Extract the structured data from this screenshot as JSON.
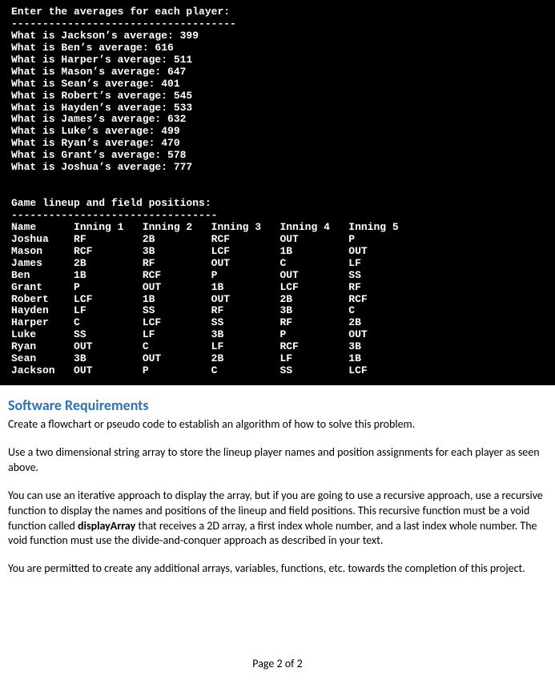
{
  "console": {
    "prompt_header": "Enter the averages for each player:",
    "divider": "------------------------------------",
    "prompts": [
      {
        "name": "Jackson",
        "value": "399"
      },
      {
        "name": "Ben",
        "value": "616"
      },
      {
        "name": "Harper",
        "value": "511"
      },
      {
        "name": "Mason",
        "value": "647"
      },
      {
        "name": "Sean",
        "value": "401"
      },
      {
        "name": "Robert",
        "value": "545"
      },
      {
        "name": "Hayden",
        "value": "533"
      },
      {
        "name": "James",
        "value": "632"
      },
      {
        "name": "Luke",
        "value": "499"
      },
      {
        "name": "Ryan",
        "value": "470"
      },
      {
        "name": "Grant",
        "value": "578"
      },
      {
        "name": "Joshua",
        "value": "777"
      }
    ],
    "lineup_title": "Game lineup and field positions:",
    "lineup_divider": "---------------------------------",
    "table": {
      "headers": [
        "Name",
        "Inning 1",
        "Inning 2",
        "Inning 3",
        "Inning 4",
        "Inning 5"
      ],
      "rows": [
        [
          "Joshua",
          "RF",
          "2B",
          "RCF",
          "OUT",
          "P"
        ],
        [
          "Mason",
          "RCF",
          "3B",
          "LCF",
          "1B",
          "OUT"
        ],
        [
          "James",
          "2B",
          "RF",
          "OUT",
          "C",
          "LF"
        ],
        [
          "Ben",
          "1B",
          "RCF",
          "P",
          "OUT",
          "SS"
        ],
        [
          "Grant",
          "P",
          "OUT",
          "1B",
          "LCF",
          "RF"
        ],
        [
          "Robert",
          "LCF",
          "1B",
          "OUT",
          "2B",
          "RCF"
        ],
        [
          "Hayden",
          "LF",
          "SS",
          "RF",
          "3B",
          "C"
        ],
        [
          "Harper",
          "C",
          "LCF",
          "SS",
          "RF",
          "2B"
        ],
        [
          "Luke",
          "SS",
          "LF",
          "3B",
          "P",
          "OUT"
        ],
        [
          "Ryan",
          "OUT",
          "C",
          "LF",
          "RCF",
          "3B"
        ],
        [
          "Sean",
          "3B",
          "OUT",
          "2B",
          "LF",
          "1B"
        ],
        [
          "Jackson",
          "OUT",
          "P",
          "C",
          "SS",
          "LCF"
        ]
      ]
    }
  },
  "doc": {
    "heading": "Software Requirements",
    "p1": "Create a flowchart or pseudo code to establish an algorithm of how to solve this problem.",
    "p2": "Use a two dimensional string array to store the lineup player names and position assignments for each player as seen above.",
    "p3a": "You can use an iterative approach to display the array, but if you are going to use a recursive approach, use a recursive function to display the names and positions of the lineup and field positions. This recursive function must be a void function called ",
    "p3b": "displayArray",
    "p3c": " that receives a 2D array, a first index whole number, and a last index whole number.  The void function must use the divide-and-conquer approach as described in your text.",
    "p4": "You are permitted to create any additional arrays, variables, functions, etc. towards the completion of this project.",
    "footer": "Page 2 of 2"
  }
}
